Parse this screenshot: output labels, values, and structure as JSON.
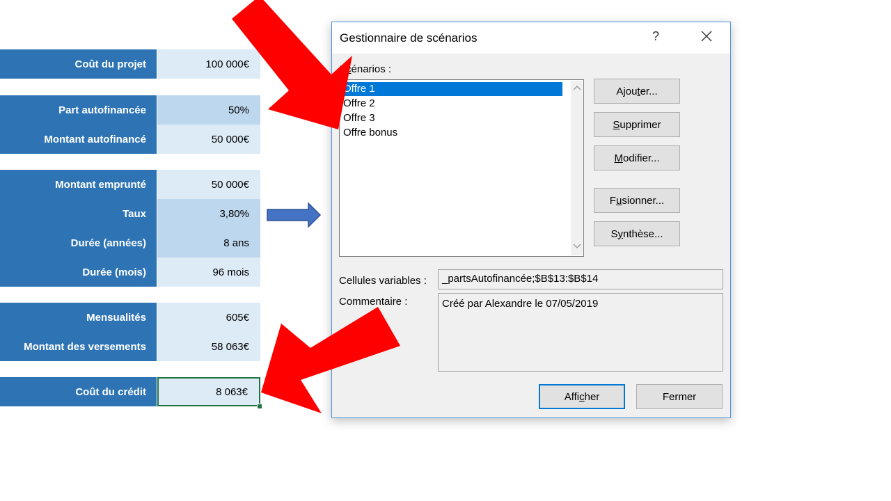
{
  "sheet": {
    "rows": [
      {
        "label": "Coût du projet",
        "value": "100 000€"
      },
      {
        "label": "Part autofinancée",
        "value": "50%"
      },
      {
        "label": "Montant autofinancé",
        "value": "50 000€"
      },
      {
        "label": "Montant emprunté",
        "value": "50 000€"
      },
      {
        "label": "Taux",
        "value": "3,80%"
      },
      {
        "label": "Durée (années)",
        "value": "8 ans"
      },
      {
        "label": "Durée (mois)",
        "value": "96 mois"
      },
      {
        "label": "Mensualités",
        "value": "605€"
      },
      {
        "label": "Montant des versements",
        "value": "58 063€"
      },
      {
        "label": "Coût du crédit",
        "value": "8 063€"
      }
    ]
  },
  "dialog": {
    "title": "Gestionnaire de scénarios",
    "help": "?",
    "scenarios_label": {
      "pre": "S",
      "u": "c",
      "post": "énarios :"
    },
    "scenarios": [
      "Offre 1",
      "Offre 2",
      "Offre 3",
      "Offre bonus"
    ],
    "buttons": {
      "add": {
        "pre": "Ajou",
        "u": "t",
        "post": "er..."
      },
      "delete": {
        "pre": "",
        "u": "S",
        "post": "upprimer"
      },
      "modify": {
        "pre": "",
        "u": "M",
        "post": "odifier..."
      },
      "merge": {
        "pre": "F",
        "u": "u",
        "post": "sionner..."
      },
      "summary": {
        "pre": "S",
        "u": "y",
        "post": "nthèse..."
      },
      "show": {
        "pre": "Affi",
        "u": "c",
        "post": "her"
      },
      "close": "Fermer"
    },
    "variable_cells_label": "Cellules variables :",
    "variable_cells_value": "_partsAutofinancée;$B$13:$B$14",
    "comment_label": "Commentaire :",
    "comment_value": "Créé par Alexandre le 07/05/2019"
  },
  "colors": {
    "label_bg": "#2e74b5",
    "value_light": "#ddebf7",
    "value_mid": "#bdd7ee",
    "red_arrow": "#ff0000",
    "blue_arrow": "#4472c4"
  }
}
